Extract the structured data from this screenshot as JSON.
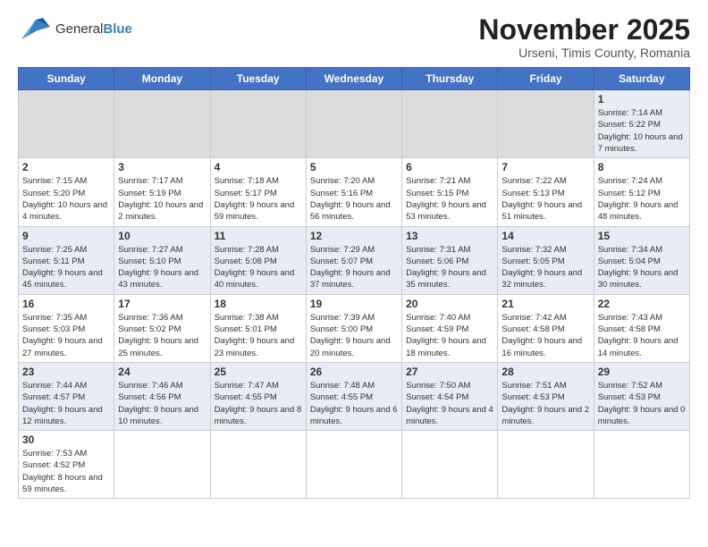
{
  "logo": {
    "text_general": "General",
    "text_blue": "Blue"
  },
  "header": {
    "month_year": "November 2025",
    "location": "Urseni, Timis County, Romania"
  },
  "weekdays": [
    "Sunday",
    "Monday",
    "Tuesday",
    "Wednesday",
    "Thursday",
    "Friday",
    "Saturday"
  ],
  "weeks": [
    [
      {
        "day": "",
        "empty": true
      },
      {
        "day": "",
        "empty": true
      },
      {
        "day": "",
        "empty": true
      },
      {
        "day": "",
        "empty": true
      },
      {
        "day": "",
        "empty": true
      },
      {
        "day": "",
        "empty": true
      },
      {
        "day": "1",
        "sunrise": "7:14 AM",
        "sunset": "5:22 PM",
        "daylight": "10 hours and 7 minutes."
      }
    ],
    [
      {
        "day": "2",
        "sunrise": "7:15 AM",
        "sunset": "5:20 PM",
        "daylight": "10 hours and 4 minutes."
      },
      {
        "day": "3",
        "sunrise": "7:17 AM",
        "sunset": "5:19 PM",
        "daylight": "10 hours and 2 minutes."
      },
      {
        "day": "4",
        "sunrise": "7:18 AM",
        "sunset": "5:17 PM",
        "daylight": "9 hours and 59 minutes."
      },
      {
        "day": "5",
        "sunrise": "7:20 AM",
        "sunset": "5:16 PM",
        "daylight": "9 hours and 56 minutes."
      },
      {
        "day": "6",
        "sunrise": "7:21 AM",
        "sunset": "5:15 PM",
        "daylight": "9 hours and 53 minutes."
      },
      {
        "day": "7",
        "sunrise": "7:22 AM",
        "sunset": "5:13 PM",
        "daylight": "9 hours and 51 minutes."
      },
      {
        "day": "8",
        "sunrise": "7:24 AM",
        "sunset": "5:12 PM",
        "daylight": "9 hours and 48 minutes."
      }
    ],
    [
      {
        "day": "9",
        "sunrise": "7:25 AM",
        "sunset": "5:11 PM",
        "daylight": "9 hours and 45 minutes."
      },
      {
        "day": "10",
        "sunrise": "7:27 AM",
        "sunset": "5:10 PM",
        "daylight": "9 hours and 43 minutes."
      },
      {
        "day": "11",
        "sunrise": "7:28 AM",
        "sunset": "5:08 PM",
        "daylight": "9 hours and 40 minutes."
      },
      {
        "day": "12",
        "sunrise": "7:29 AM",
        "sunset": "5:07 PM",
        "daylight": "9 hours and 37 minutes."
      },
      {
        "day": "13",
        "sunrise": "7:31 AM",
        "sunset": "5:06 PM",
        "daylight": "9 hours and 35 minutes."
      },
      {
        "day": "14",
        "sunrise": "7:32 AM",
        "sunset": "5:05 PM",
        "daylight": "9 hours and 32 minutes."
      },
      {
        "day": "15",
        "sunrise": "7:34 AM",
        "sunset": "5:04 PM",
        "daylight": "9 hours and 30 minutes."
      }
    ],
    [
      {
        "day": "16",
        "sunrise": "7:35 AM",
        "sunset": "5:03 PM",
        "daylight": "9 hours and 27 minutes."
      },
      {
        "day": "17",
        "sunrise": "7:36 AM",
        "sunset": "5:02 PM",
        "daylight": "9 hours and 25 minutes."
      },
      {
        "day": "18",
        "sunrise": "7:38 AM",
        "sunset": "5:01 PM",
        "daylight": "9 hours and 23 minutes."
      },
      {
        "day": "19",
        "sunrise": "7:39 AM",
        "sunset": "5:00 PM",
        "daylight": "9 hours and 20 minutes."
      },
      {
        "day": "20",
        "sunrise": "7:40 AM",
        "sunset": "4:59 PM",
        "daylight": "9 hours and 18 minutes."
      },
      {
        "day": "21",
        "sunrise": "7:42 AM",
        "sunset": "4:58 PM",
        "daylight": "9 hours and 16 minutes."
      },
      {
        "day": "22",
        "sunrise": "7:43 AM",
        "sunset": "4:58 PM",
        "daylight": "9 hours and 14 minutes."
      }
    ],
    [
      {
        "day": "23",
        "sunrise": "7:44 AM",
        "sunset": "4:57 PM",
        "daylight": "9 hours and 12 minutes."
      },
      {
        "day": "24",
        "sunrise": "7:46 AM",
        "sunset": "4:56 PM",
        "daylight": "9 hours and 10 minutes."
      },
      {
        "day": "25",
        "sunrise": "7:47 AM",
        "sunset": "4:55 PM",
        "daylight": "9 hours and 8 minutes."
      },
      {
        "day": "26",
        "sunrise": "7:48 AM",
        "sunset": "4:55 PM",
        "daylight": "9 hours and 6 minutes."
      },
      {
        "day": "27",
        "sunrise": "7:50 AM",
        "sunset": "4:54 PM",
        "daylight": "9 hours and 4 minutes."
      },
      {
        "day": "28",
        "sunrise": "7:51 AM",
        "sunset": "4:53 PM",
        "daylight": "9 hours and 2 minutes."
      },
      {
        "day": "29",
        "sunrise": "7:52 AM",
        "sunset": "4:53 PM",
        "daylight": "9 hours and 0 minutes."
      }
    ],
    [
      {
        "day": "30",
        "sunrise": "7:53 AM",
        "sunset": "4:52 PM",
        "daylight": "8 hours and 59 minutes."
      },
      {
        "day": "",
        "empty": true
      },
      {
        "day": "",
        "empty": true
      },
      {
        "day": "",
        "empty": true
      },
      {
        "day": "",
        "empty": true
      },
      {
        "day": "",
        "empty": true
      },
      {
        "day": "",
        "empty": true
      }
    ]
  ]
}
